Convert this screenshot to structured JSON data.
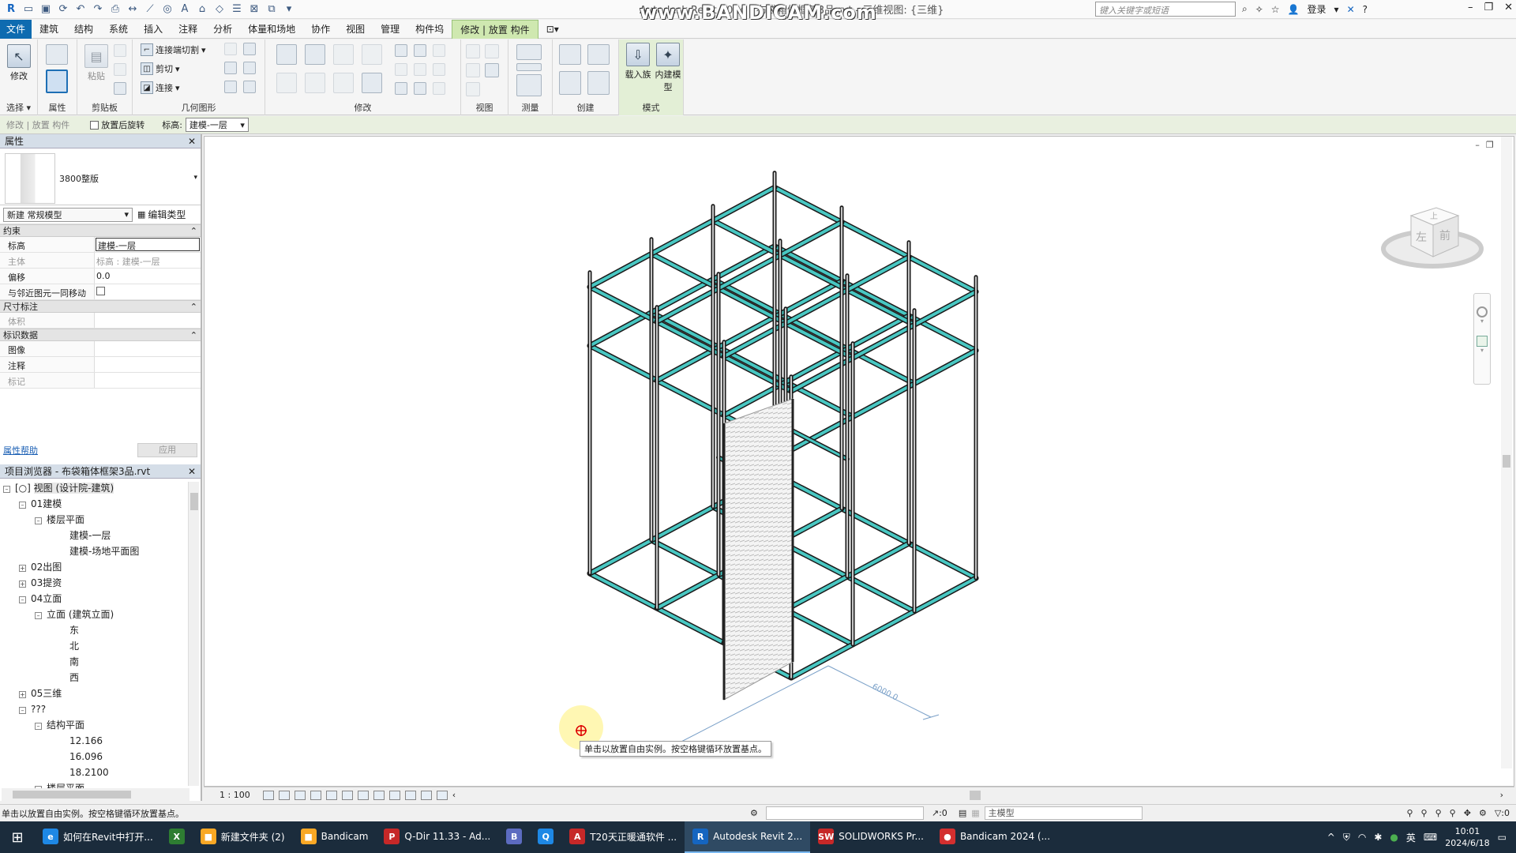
{
  "title": {
    "app_title": "Autodesk Revit 2024 - 布袋箱体框架3品.rvt - 三维视图: {三维}",
    "watermark": "www.BANDICAM.com",
    "search_placeholder": "键入关键字或短语",
    "login": "登录"
  },
  "tabs": [
    "文件",
    "建筑",
    "结构",
    "系统",
    "插入",
    "注释",
    "分析",
    "体量和场地",
    "协作",
    "视图",
    "管理",
    "构件坞",
    "修改 | 放置 构件"
  ],
  "ribbon": {
    "modify": "修改",
    "select": "选择",
    "properties": "属性",
    "paste": "粘贴",
    "clipboard": "剪贴板",
    "cope": "连接端切割",
    "cut": "剪切",
    "join": "连接",
    "geometry": "几何图形",
    "modify_panel": "修改",
    "view_panel": "视图",
    "measure_panel": "测量",
    "create_panel": "创建",
    "load_family": "载入族",
    "inplace_model": "内建模型",
    "mode_panel": "模式"
  },
  "options_bar": {
    "context": "修改 | 放置 构件",
    "rotate_label": "放置后旋转",
    "level_label": "标高:",
    "level_value": "建模-一层"
  },
  "properties": {
    "header": "属性",
    "type_name": "3800整版",
    "instance_select": "新建 常规模型",
    "edit_type": "编辑类型",
    "groups": {
      "constraints": "约束",
      "dimensions": "尺寸标注",
      "identity": "标识数据"
    },
    "rows": {
      "level_k": "标高",
      "level_v": "建模-一层",
      "host_k": "主体",
      "host_v": "标高 : 建模-一层",
      "offset_k": "偏移",
      "offset_v": "0.0",
      "move_k": "与邻近图元一同移动",
      "volume_k": "体积",
      "image_k": "图像",
      "comment_k": "注释",
      "mark_k": "标记"
    },
    "help": "属性帮助",
    "apply": "应用"
  },
  "browser": {
    "header": "项目浏览器 - 布袋箱体框架3品.rvt",
    "nodes": {
      "views": "视图 (设计院-建筑)",
      "n01": "01建模",
      "floorplans": "楼层平面",
      "fp1": "建模-一层",
      "fp2": "建模-场地平面图",
      "n02": "02出图",
      "n03": "03提资",
      "n04": "04立面",
      "elev": "立面 (建筑立面)",
      "east": "东",
      "north": "北",
      "south": "南",
      "west": "西",
      "n05": "05三维",
      "unk": "???",
      "struct": "结构平面",
      "s1": "12.166",
      "s2": "16.096",
      "s3": "18.2100",
      "more": "楼层平面"
    }
  },
  "viewport": {
    "dimension": "6000.0",
    "tooltip": "单击以放置自由实例。按空格键循环放置基点。",
    "cube_left": "左",
    "cube_front": "前",
    "cube_top": "上"
  },
  "viewbar": {
    "scale": "1 : 100"
  },
  "status": {
    "message": "单击以放置自由实例。按空格键循环放置基点。",
    "sel_count": ":0",
    "model": "主模型",
    "filter_count": ":0"
  },
  "taskbar": {
    "apps": [
      {
        "label": "如何在Revit中打开...",
        "color": "#1e88e5",
        "glyph": "e"
      },
      {
        "label": "",
        "color": "#2e7d32",
        "glyph": "X"
      },
      {
        "label": "新建文件夹 (2)",
        "color": "#f9a825",
        "glyph": "■"
      },
      {
        "label": "Bandicam",
        "color": "#f9a825",
        "glyph": "■"
      },
      {
        "label": "Q-Dir 11.33 - Ad...",
        "color": "#c62828",
        "glyph": "P"
      },
      {
        "label": "",
        "color": "#5c6bc0",
        "glyph": "B"
      },
      {
        "label": "",
        "color": "#1e88e5",
        "glyph": "Q"
      },
      {
        "label": "T20天正暖通软件 ...",
        "color": "#c62828",
        "glyph": "A"
      },
      {
        "label": "Autodesk Revit 2...",
        "color": "#1565c0",
        "glyph": "R"
      },
      {
        "label": "SOLIDWORKS Pr...",
        "color": "#c62828",
        "glyph": "SW"
      },
      {
        "label": "Bandicam 2024 (...",
        "color": "#d32f2f",
        "glyph": "●"
      }
    ],
    "ime": "英",
    "time": "10:01",
    "date": "2024/6/18"
  }
}
